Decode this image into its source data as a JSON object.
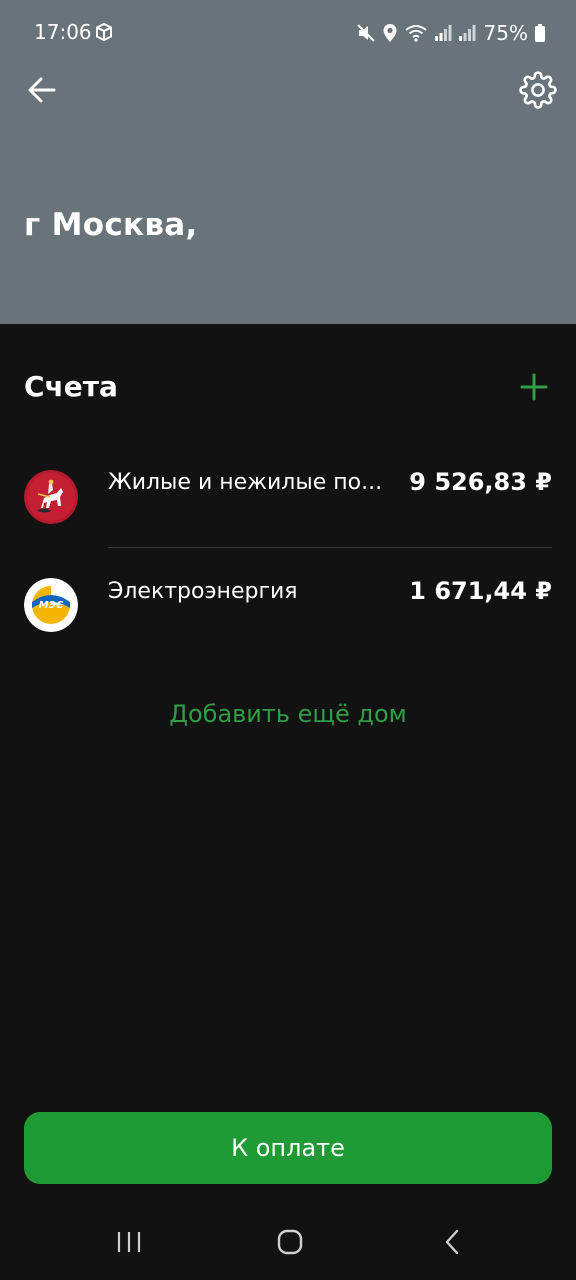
{
  "status_bar": {
    "time": "17:06",
    "battery": "75%"
  },
  "header": {
    "address": "г Москва,"
  },
  "accounts_section": {
    "title": "Счета",
    "items": [
      {
        "name": "Жилые и нежилые по...",
        "amount": "9 526,83 ₽",
        "logo_icon": "moscow-coat-of-arms-icon"
      },
      {
        "name": "Электроэнергия",
        "amount": "1 671,44 ₽",
        "logo_icon": "mes-logo-icon",
        "logo_text": "МЭС"
      }
    ]
  },
  "add_house_label": "Добавить ещё дом",
  "pay_button_label": "К оплате",
  "colors": {
    "header_bg": "#69747a",
    "screen_bg": "#121212",
    "accent_green": "#1f9a35",
    "link_green": "#2f9e44"
  }
}
